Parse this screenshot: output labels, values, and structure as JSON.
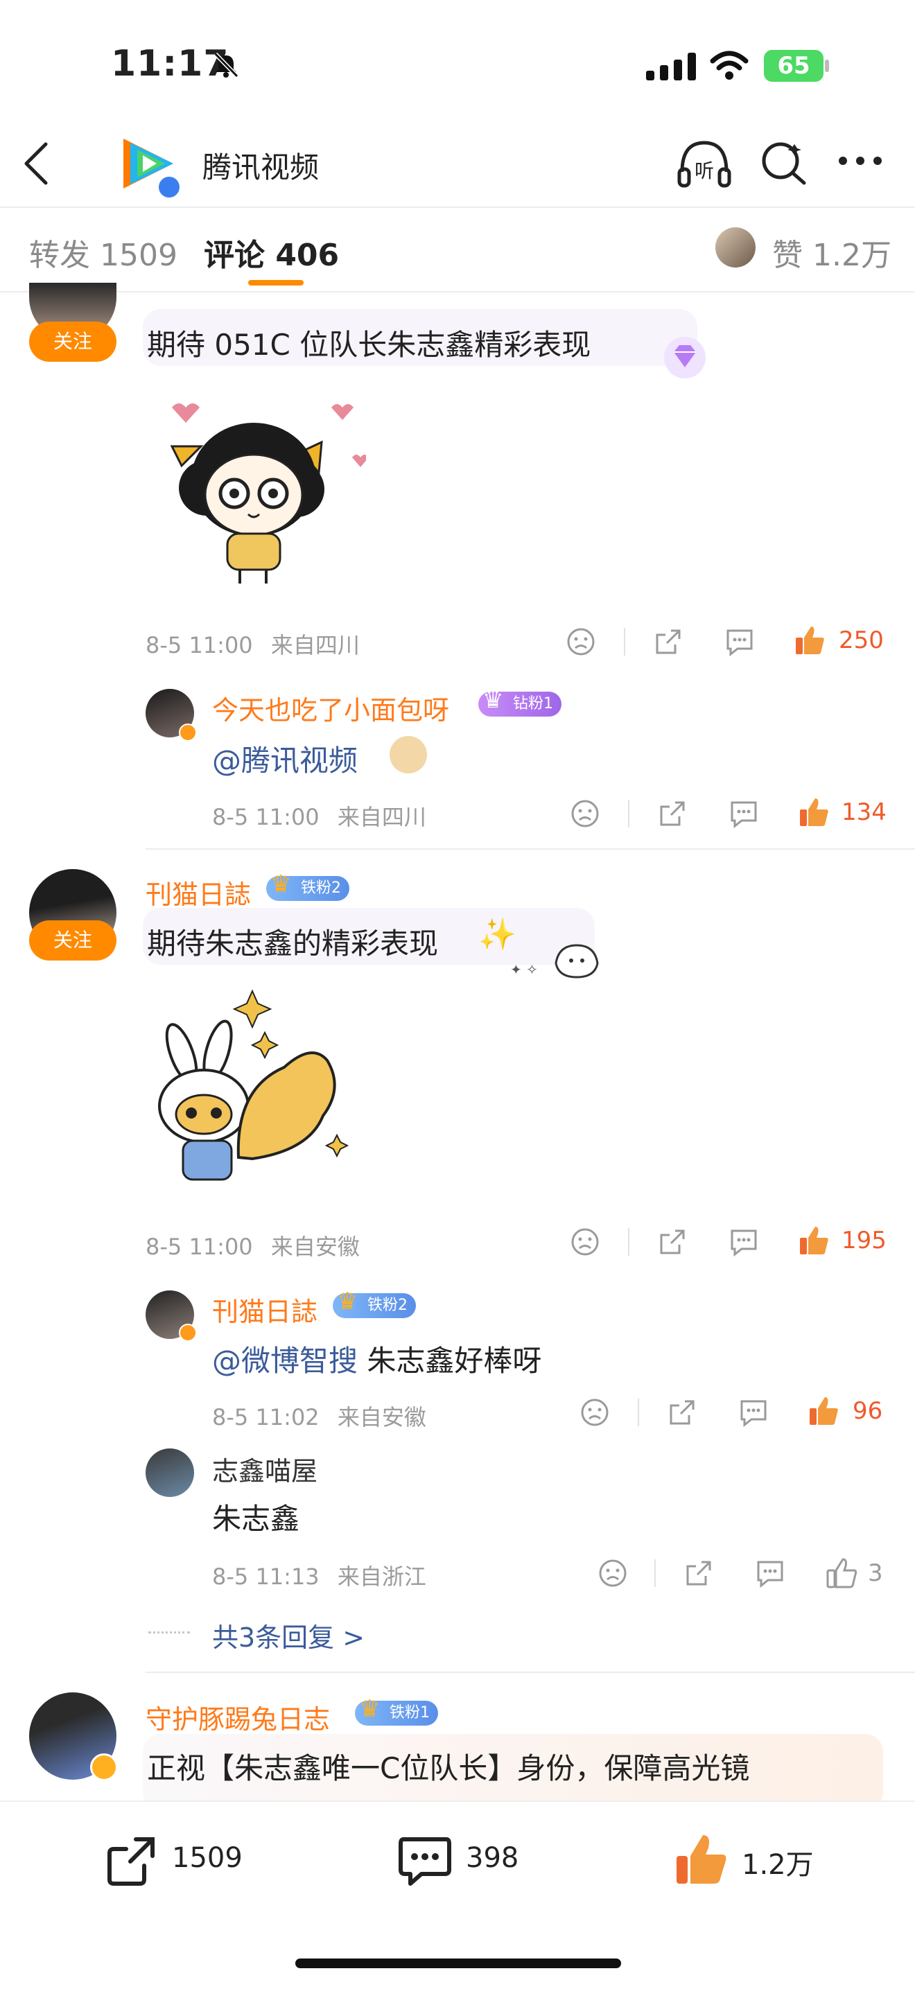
{
  "status_bar": {
    "time": "11:17",
    "battery": "65"
  },
  "nav": {
    "title": "腾讯视频"
  },
  "tabs": {
    "repost": "转发 1509",
    "comments": "评论 406",
    "likes": "赞 1.2万"
  },
  "comments": [
    {
      "follow": "关注",
      "text": "期待 051C 位队长朱志鑫精彩表现",
      "time": "8-5 11:00",
      "location": "来自四川",
      "likes": "250",
      "replies": [
        {
          "user": "今天也吃了小面包呀",
          "badge": "钻粉1",
          "mention": "@腾讯视频",
          "time": "8-5 11:00",
          "location": "来自四川",
          "likes": "134"
        }
      ]
    },
    {
      "user": "刊猫日誌",
      "badge": "铁粉2",
      "follow": "关注",
      "text": "期待朱志鑫的精彩表现",
      "time": "8-5 11:00",
      "location": "来自安徽",
      "likes": "195",
      "replies": [
        {
          "user": "刊猫日誌",
          "badge": "铁粉2",
          "mention": "@微博智搜",
          "text": " 朱志鑫好棒呀",
          "time": "8-5 11:02",
          "location": "来自安徽",
          "likes": "96"
        },
        {
          "user": "志鑫喵屋",
          "text": "朱志鑫",
          "time": "8-5 11:13",
          "location": "来自浙江",
          "likes": "3"
        }
      ],
      "more_replies": "共3条回复 >"
    },
    {
      "user": "守护豚踢兔日志",
      "badge": "铁粉1",
      "text": "正视【朱志鑫唯一C位队长】身份，保障高光镜"
    }
  ],
  "bottom_bar": {
    "reposts": "1509",
    "comments": "398",
    "likes": "1.2万"
  },
  "colors": {
    "accent": "#ff7a1a",
    "like": "#ef5a2a",
    "link": "#3b5b9b"
  }
}
